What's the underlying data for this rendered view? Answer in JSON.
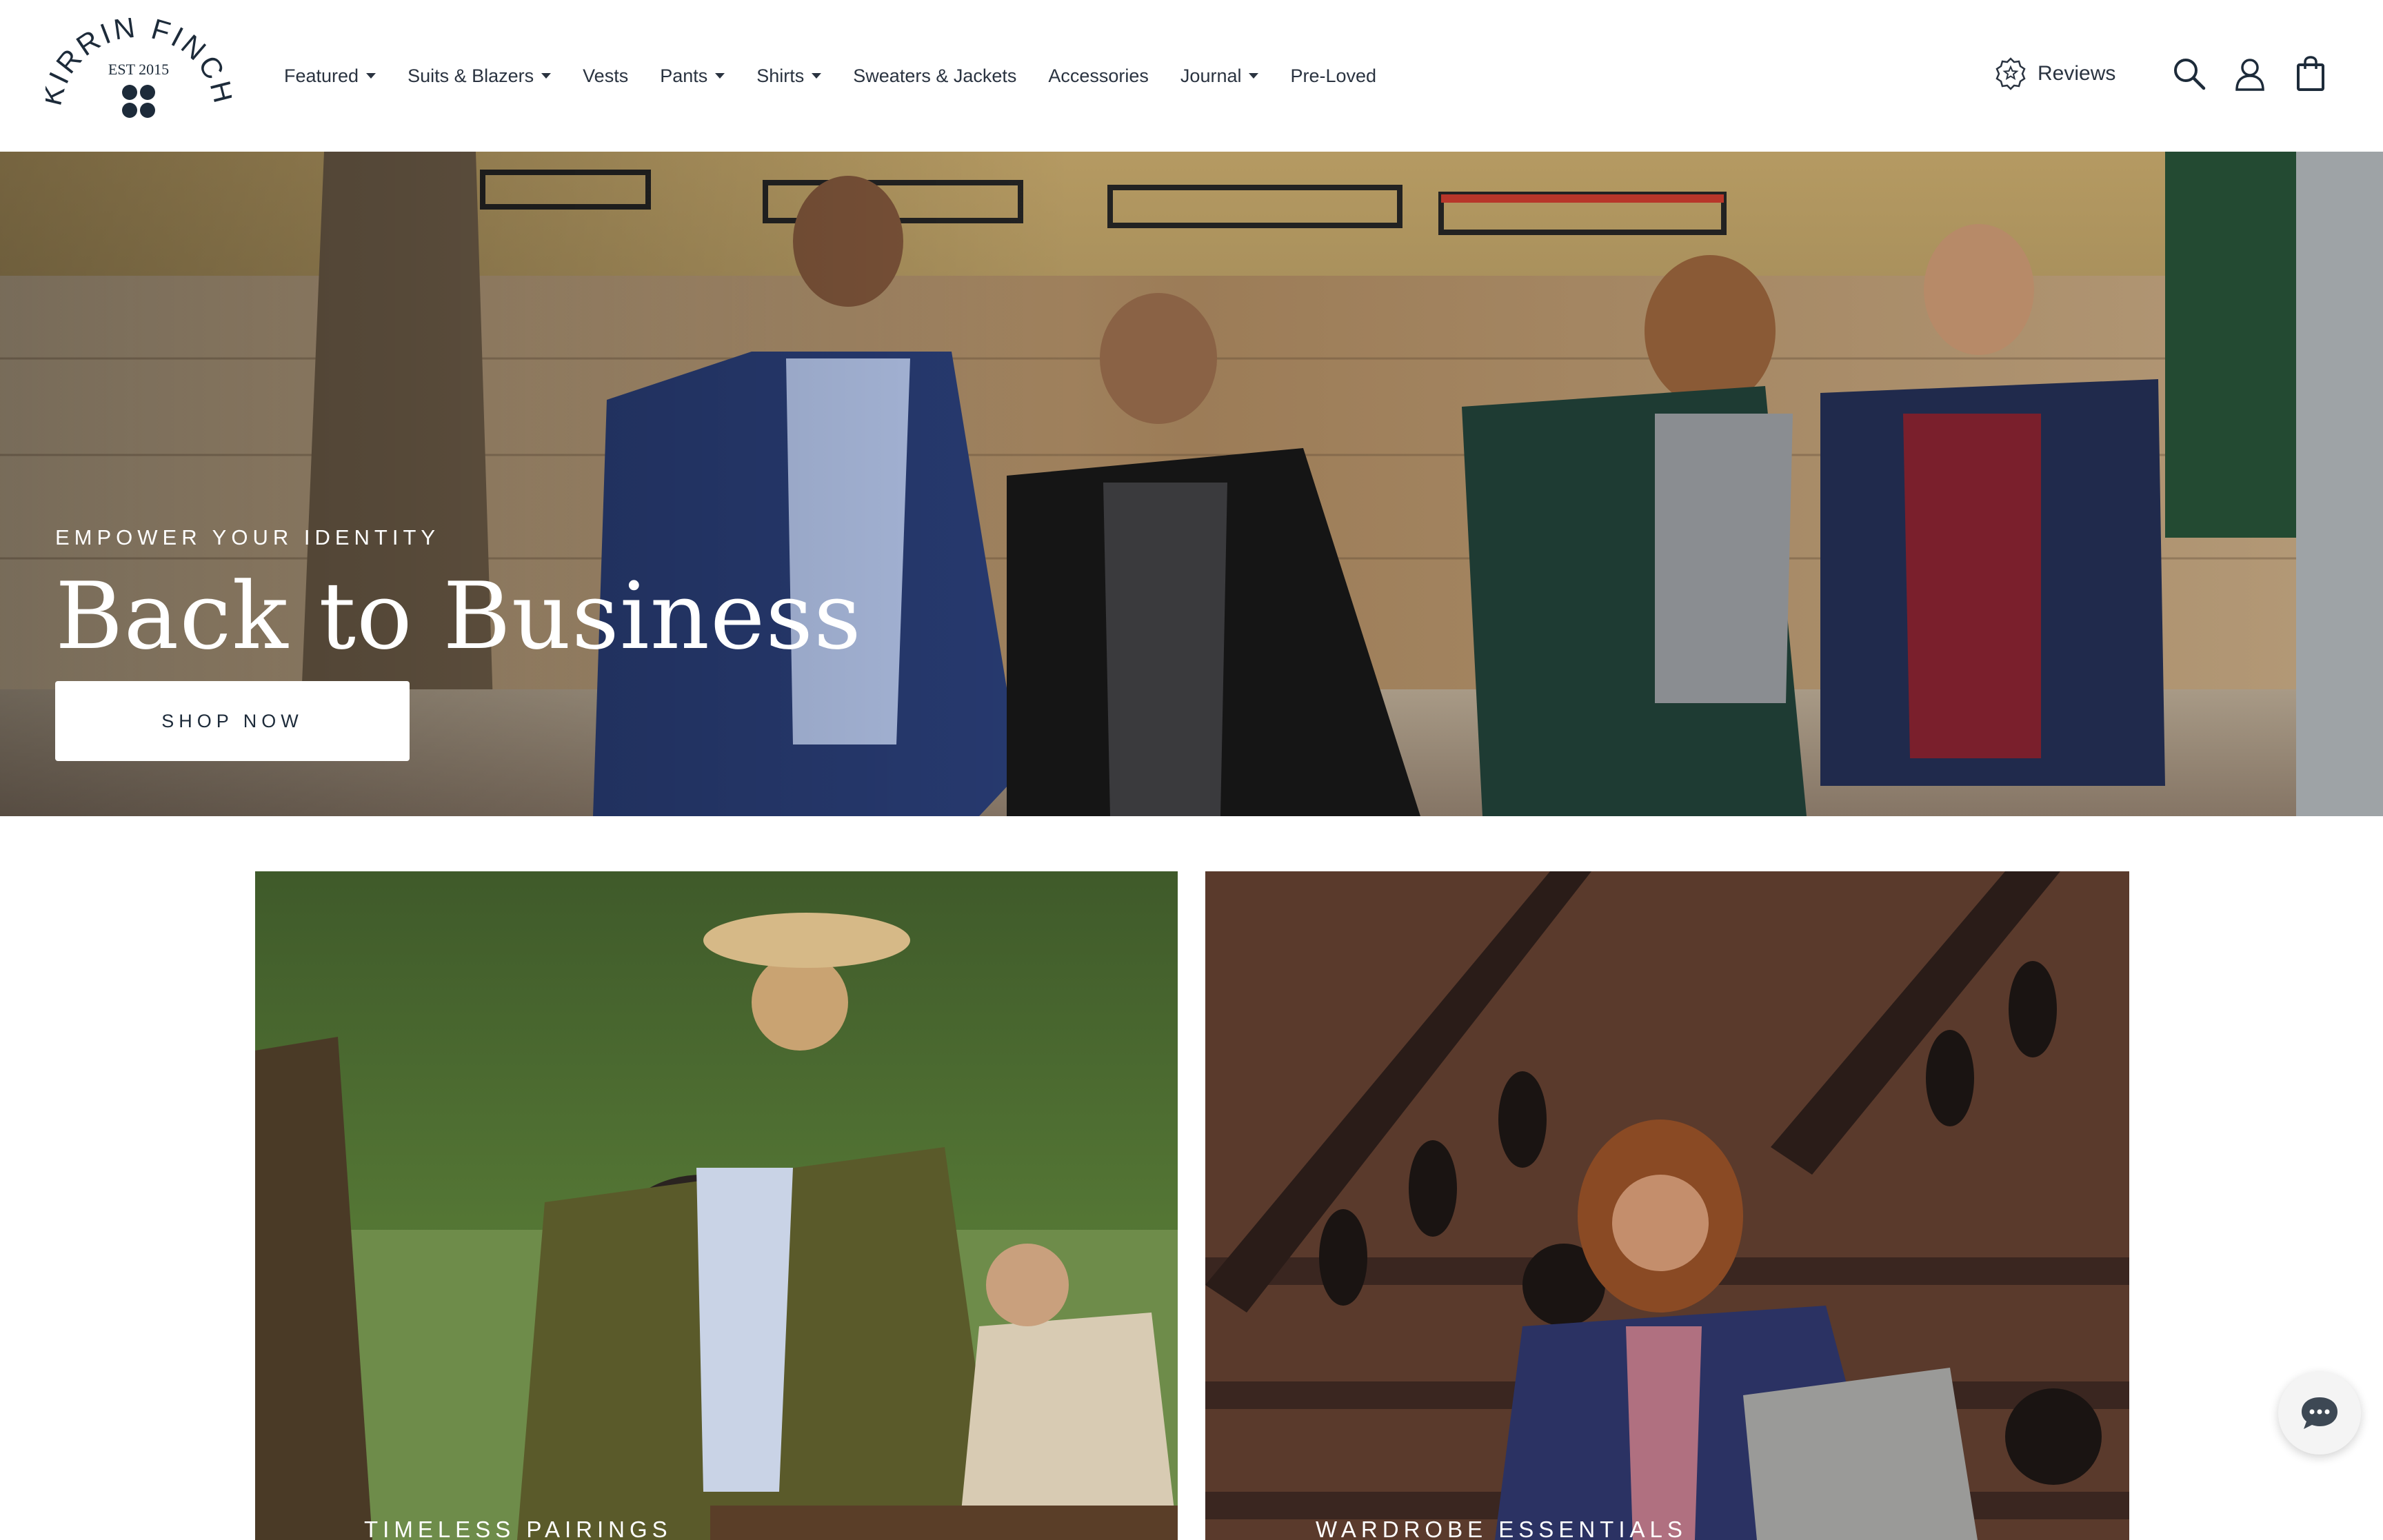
{
  "brand": {
    "name_line": "KIRRIN FINCH",
    "est": "EST 2015"
  },
  "nav": {
    "items": [
      {
        "label": "Featured",
        "has_dropdown": true
      },
      {
        "label": "Suits & Blazers",
        "has_dropdown": true
      },
      {
        "label": "Vests",
        "has_dropdown": false
      },
      {
        "label": "Pants",
        "has_dropdown": true
      },
      {
        "label": "Shirts",
        "has_dropdown": true
      },
      {
        "label": "Sweaters & Jackets",
        "has_dropdown": false
      },
      {
        "label": "Accessories",
        "has_dropdown": false
      },
      {
        "label": "Journal",
        "has_dropdown": true
      },
      {
        "label": "Pre-Loved",
        "has_dropdown": false
      }
    ]
  },
  "header_actions": {
    "reviews_label": "Reviews",
    "icons": [
      "star-badge-icon",
      "search-icon",
      "account-icon",
      "cart-icon"
    ]
  },
  "hero": {
    "kicker": "EMPOWER YOUR IDENTITY",
    "title": "Back to Business",
    "button_label": "SHOP NOW"
  },
  "tiles": [
    {
      "label": "TIMELESS PAIRINGS"
    },
    {
      "label": "WARDROBE ESSENTIALS"
    }
  ],
  "colors": {
    "brand_navy": "#1d2b3a",
    "text": "#2a3340",
    "white": "#ffffff"
  },
  "chat": {
    "icon": "chat-bubble-icon"
  }
}
